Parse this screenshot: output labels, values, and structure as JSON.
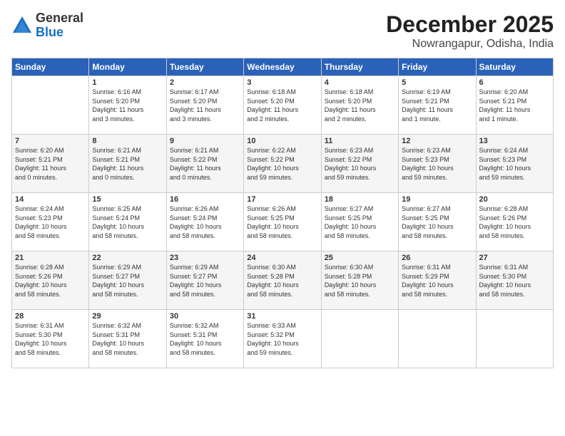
{
  "header": {
    "logo": {
      "general": "General",
      "blue": "Blue"
    },
    "month": "December 2025",
    "location": "Nowrangapur, Odisha, India"
  },
  "weekdays": [
    "Sunday",
    "Monday",
    "Tuesday",
    "Wednesday",
    "Thursday",
    "Friday",
    "Saturday"
  ],
  "weeks": [
    [
      {
        "day": "",
        "info": ""
      },
      {
        "day": "1",
        "info": "Sunrise: 6:16 AM\nSunset: 5:20 PM\nDaylight: 11 hours\nand 3 minutes."
      },
      {
        "day": "2",
        "info": "Sunrise: 6:17 AM\nSunset: 5:20 PM\nDaylight: 11 hours\nand 3 minutes."
      },
      {
        "day": "3",
        "info": "Sunrise: 6:18 AM\nSunset: 5:20 PM\nDaylight: 11 hours\nand 2 minutes."
      },
      {
        "day": "4",
        "info": "Sunrise: 6:18 AM\nSunset: 5:20 PM\nDaylight: 11 hours\nand 2 minutes."
      },
      {
        "day": "5",
        "info": "Sunrise: 6:19 AM\nSunset: 5:21 PM\nDaylight: 11 hours\nand 1 minute."
      },
      {
        "day": "6",
        "info": "Sunrise: 6:20 AM\nSunset: 5:21 PM\nDaylight: 11 hours\nand 1 minute."
      }
    ],
    [
      {
        "day": "7",
        "info": "Sunrise: 6:20 AM\nSunset: 5:21 PM\nDaylight: 11 hours\nand 0 minutes."
      },
      {
        "day": "8",
        "info": "Sunrise: 6:21 AM\nSunset: 5:21 PM\nDaylight: 11 hours\nand 0 minutes."
      },
      {
        "day": "9",
        "info": "Sunrise: 6:21 AM\nSunset: 5:22 PM\nDaylight: 11 hours\nand 0 minutes."
      },
      {
        "day": "10",
        "info": "Sunrise: 6:22 AM\nSunset: 5:22 PM\nDaylight: 10 hours\nand 59 minutes."
      },
      {
        "day": "11",
        "info": "Sunrise: 6:23 AM\nSunset: 5:22 PM\nDaylight: 10 hours\nand 59 minutes."
      },
      {
        "day": "12",
        "info": "Sunrise: 6:23 AM\nSunset: 5:23 PM\nDaylight: 10 hours\nand 59 minutes."
      },
      {
        "day": "13",
        "info": "Sunrise: 6:24 AM\nSunset: 5:23 PM\nDaylight: 10 hours\nand 59 minutes."
      }
    ],
    [
      {
        "day": "14",
        "info": "Sunrise: 6:24 AM\nSunset: 5:23 PM\nDaylight: 10 hours\nand 58 minutes."
      },
      {
        "day": "15",
        "info": "Sunrise: 6:25 AM\nSunset: 5:24 PM\nDaylight: 10 hours\nand 58 minutes."
      },
      {
        "day": "16",
        "info": "Sunrise: 6:26 AM\nSunset: 5:24 PM\nDaylight: 10 hours\nand 58 minutes."
      },
      {
        "day": "17",
        "info": "Sunrise: 6:26 AM\nSunset: 5:25 PM\nDaylight: 10 hours\nand 58 minutes."
      },
      {
        "day": "18",
        "info": "Sunrise: 6:27 AM\nSunset: 5:25 PM\nDaylight: 10 hours\nand 58 minutes."
      },
      {
        "day": "19",
        "info": "Sunrise: 6:27 AM\nSunset: 5:25 PM\nDaylight: 10 hours\nand 58 minutes."
      },
      {
        "day": "20",
        "info": "Sunrise: 6:28 AM\nSunset: 5:26 PM\nDaylight: 10 hours\nand 58 minutes."
      }
    ],
    [
      {
        "day": "21",
        "info": "Sunrise: 6:28 AM\nSunset: 5:26 PM\nDaylight: 10 hours\nand 58 minutes."
      },
      {
        "day": "22",
        "info": "Sunrise: 6:29 AM\nSunset: 5:27 PM\nDaylight: 10 hours\nand 58 minutes."
      },
      {
        "day": "23",
        "info": "Sunrise: 6:29 AM\nSunset: 5:27 PM\nDaylight: 10 hours\nand 58 minutes."
      },
      {
        "day": "24",
        "info": "Sunrise: 6:30 AM\nSunset: 5:28 PM\nDaylight: 10 hours\nand 58 minutes."
      },
      {
        "day": "25",
        "info": "Sunrise: 6:30 AM\nSunset: 5:28 PM\nDaylight: 10 hours\nand 58 minutes."
      },
      {
        "day": "26",
        "info": "Sunrise: 6:31 AM\nSunset: 5:29 PM\nDaylight: 10 hours\nand 58 minutes."
      },
      {
        "day": "27",
        "info": "Sunrise: 6:31 AM\nSunset: 5:30 PM\nDaylight: 10 hours\nand 58 minutes."
      }
    ],
    [
      {
        "day": "28",
        "info": "Sunrise: 6:31 AM\nSunset: 5:30 PM\nDaylight: 10 hours\nand 58 minutes."
      },
      {
        "day": "29",
        "info": "Sunrise: 6:32 AM\nSunset: 5:31 PM\nDaylight: 10 hours\nand 58 minutes."
      },
      {
        "day": "30",
        "info": "Sunrise: 6:32 AM\nSunset: 5:31 PM\nDaylight: 10 hours\nand 58 minutes."
      },
      {
        "day": "31",
        "info": "Sunrise: 6:33 AM\nSunset: 5:32 PM\nDaylight: 10 hours\nand 59 minutes."
      },
      {
        "day": "",
        "info": ""
      },
      {
        "day": "",
        "info": ""
      },
      {
        "day": "",
        "info": ""
      }
    ]
  ]
}
